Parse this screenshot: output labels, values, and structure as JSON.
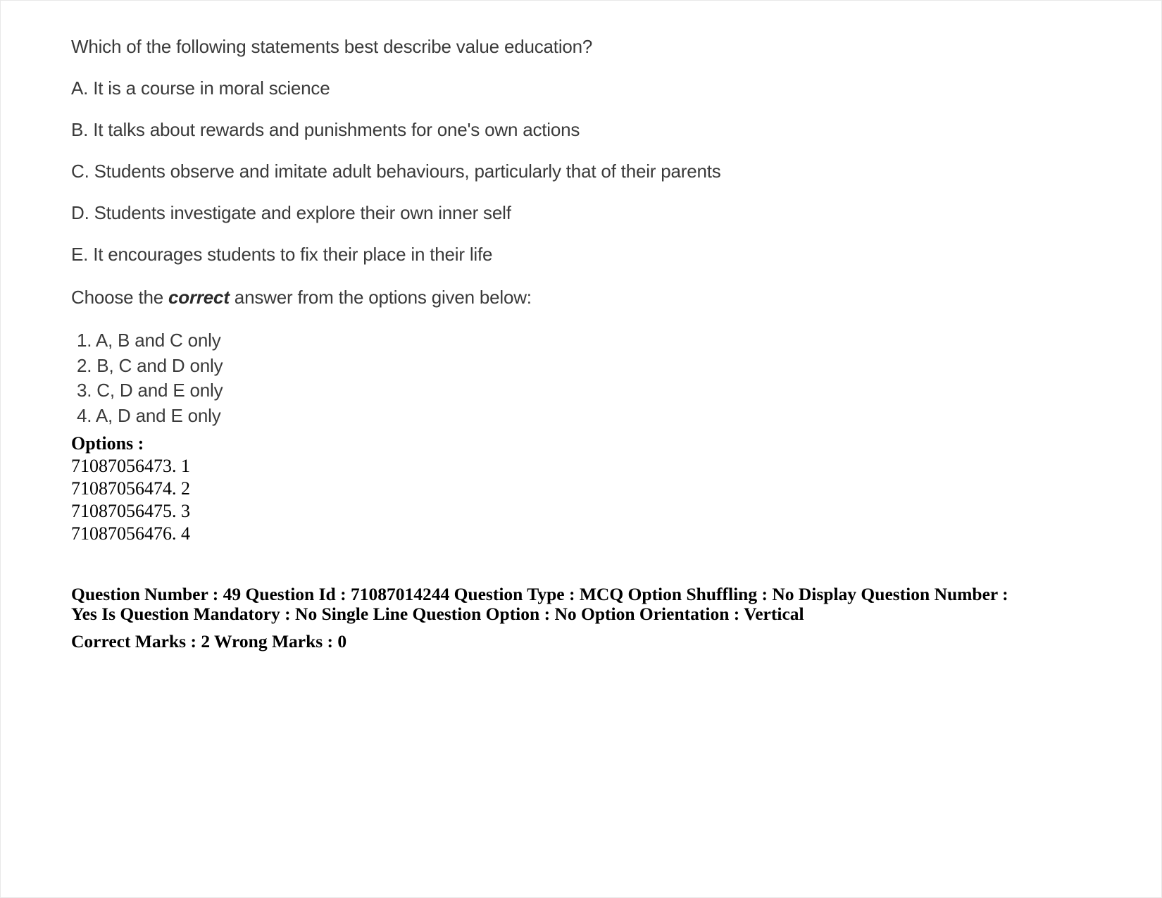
{
  "document": {
    "type": "exam-question-sheet"
  },
  "question": {
    "stem": "Which of the following statements best describe value education?",
    "statements": [
      "A. It is a course in moral science",
      "B. It talks about rewards and punishments for one's own actions",
      "C. Students observe and imitate adult behaviours, particularly that of their parents",
      "D. Students investigate and explore their own inner self",
      "E. It encourages students to fix their place in their life"
    ],
    "instruction": {
      "before": "Choose the ",
      "emphasis": "correct",
      "after": " answer from the options given below:"
    },
    "answers": [
      "1. A, B and C only",
      "2. B, C and D only",
      "3. C, D and E only",
      "4. A, D and E only"
    ]
  },
  "options": {
    "title": "Options :",
    "rows": [
      "71087056473. 1",
      "71087056474. 2",
      "71087056475. 3",
      "71087056476. 4"
    ]
  },
  "meta": {
    "line1": "Question Number : 49 Question Id : 71087014244 Question Type : MCQ Option Shuffling : No Display Question Number : Yes Is Question Mandatory : No Single Line Question Option : No Option Orientation : Vertical",
    "line2": "Correct Marks : 2 Wrong Marks : 0",
    "fields": {
      "question_number": "49",
      "question_id": "71087014244",
      "question_type": "MCQ",
      "option_shuffling": "No",
      "display_question_number": "Yes",
      "is_question_mandatory": "No",
      "single_line_question_option": "No",
      "option_orientation": "Vertical",
      "correct_marks": "2",
      "wrong_marks": "0"
    }
  }
}
